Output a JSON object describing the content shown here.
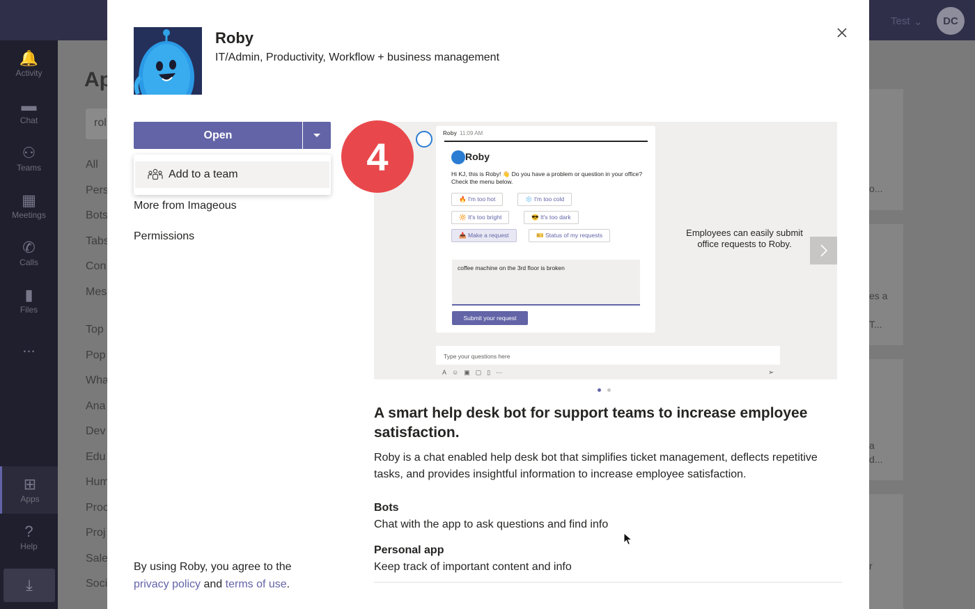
{
  "background": {
    "top_user": "Test",
    "avatar_initials": "DC",
    "page_title_partial": "Ap",
    "search_partial": "rol",
    "rail": [
      {
        "label": "Activity",
        "icon": "bell-icon"
      },
      {
        "label": "Chat",
        "icon": "chat-icon"
      },
      {
        "label": "Teams",
        "icon": "teams-icon"
      },
      {
        "label": "Meetings",
        "icon": "calendar-icon"
      },
      {
        "label": "Calls",
        "icon": "phone-icon"
      },
      {
        "label": "Files",
        "icon": "file-icon"
      },
      {
        "label": "...",
        "icon": "more-icon"
      },
      {
        "label": "Apps",
        "icon": "apps-icon"
      },
      {
        "label": "Help",
        "icon": "help-icon"
      }
    ],
    "categories_partial": [
      "All",
      "Pers",
      "Bots",
      "Tabs",
      "Con",
      "Mes",
      "Top",
      "Pop",
      "Wha",
      "Ana",
      "Dev",
      "Edu",
      "Hum",
      "Proc",
      "Proj",
      "Sale",
      "Soci"
    ],
    "right_fragments": [
      "o...",
      "es a",
      "T...",
      "a",
      "d...",
      "r"
    ]
  },
  "modal": {
    "app_name": "Roby",
    "app_categories": "IT/Admin, Productivity, Workflow + business management",
    "open_label": "Open",
    "menu_add_team": "Add to a team",
    "more_from": "More from Imageous",
    "permissions": "Permissions",
    "step_number": "4",
    "terms_prefix": "By using Roby, you agree to the",
    "privacy_link": "privacy policy",
    "terms_and": "and",
    "terms_link": "terms of use",
    "terms_end": ".",
    "headline": "A smart help desk bot for support teams to increase employee satisfaction.",
    "description": "Roby is a chat enabled help desk bot that simplifies ticket management, deflects repetitive tasks, and provides insightful information to increase employee satisfaction.",
    "features": [
      {
        "title": "Bots",
        "desc": "Chat with the app to ask questions and find info"
      },
      {
        "title": "Personal app",
        "desc": "Keep track of important content and info"
      }
    ]
  },
  "screenshot": {
    "sender": "Roby",
    "time": "11:09 AM",
    "card_title": "Roby",
    "card_desc": "Hi KJ, this is Roby! 👋 Do you have a problem or question in your office? Check the menu below.",
    "chips": [
      "🔥 I'm too hot",
      "❄️ I'm too cold",
      "🔆 It's too bright",
      "😎 It's too dark",
      "📥 Make a request",
      "🎫 Status of my requests"
    ],
    "input_text": "coffee machine on the 3rd floor is broken",
    "submit_label": "Submit your request",
    "compose_placeholder": "Type your questions here",
    "caption": "Employees can easily submit office requests to Roby."
  },
  "colors": {
    "accent": "#6264a7",
    "badge": "#e8484c",
    "text": "#252423"
  }
}
